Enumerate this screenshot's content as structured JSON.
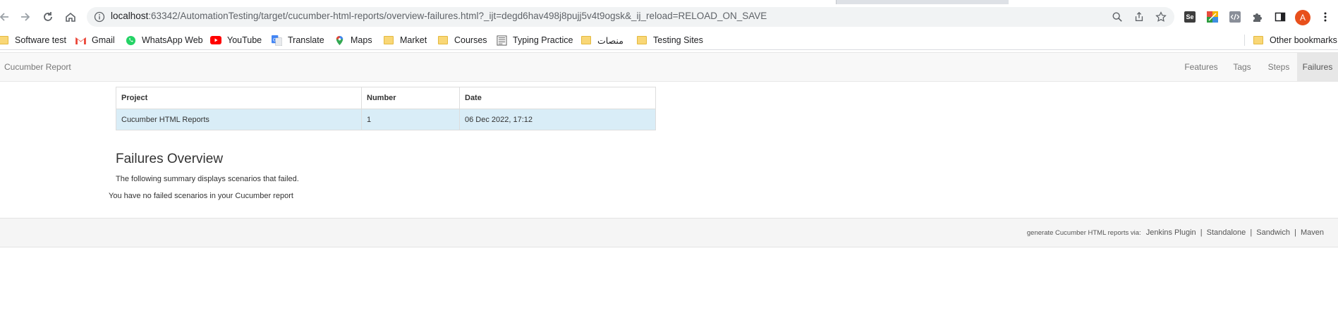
{
  "browser": {
    "url_host": "localhost",
    "url_rest": ":63342/AutomationTesting/target/cucumber-html-reports/overview-failures.html?_ijt=degd6hav498j8pujj5v4t9ogsk&_ij_reload=RELOAD_ON_SAVE",
    "avatar_letter": "A",
    "bookmarks": [
      {
        "label": "Software test",
        "icon": "folder-icon"
      },
      {
        "label": "Gmail",
        "icon": "gmail-icon"
      },
      {
        "label": "WhatsApp Web",
        "icon": "whatsapp-icon"
      },
      {
        "label": "YouTube",
        "icon": "youtube-icon"
      },
      {
        "label": "Translate",
        "icon": "translate-icon"
      },
      {
        "label": "Maps",
        "icon": "maps-icon"
      },
      {
        "label": "Market",
        "icon": "folder-icon"
      },
      {
        "label": "Courses",
        "icon": "folder-icon"
      },
      {
        "label": "Typing Practice",
        "icon": "typing-icon"
      },
      {
        "label": "منصات",
        "icon": "folder-icon"
      },
      {
        "label": "Testing Sites",
        "icon": "folder-icon"
      }
    ],
    "other_bookmarks": "Other bookmarks",
    "extension_labels": {
      "selenium": "Se"
    }
  },
  "navbar": {
    "brand": "Cucumber Report",
    "items": [
      "Features",
      "Tags",
      "Steps",
      "Failures"
    ],
    "active": "Failures"
  },
  "report_table": {
    "headers": [
      "Project",
      "Number",
      "Date"
    ],
    "row": [
      "Cucumber HTML Reports",
      "1",
      "06 Dec 2022, 17:12"
    ]
  },
  "overview": {
    "title": "Failures Overview",
    "summary": "The following summary displays scenarios that failed.",
    "empty_message": "You have no failed scenarios in your Cucumber report"
  },
  "footer": {
    "prefix": "generate Cucumber HTML reports via:",
    "links": [
      "Jenkins Plugin",
      "Standalone",
      "Sandwich",
      "Maven"
    ],
    "separator": "|"
  },
  "colors": {
    "avatar": "#e8501c",
    "table_row_bg": "#d9edf7",
    "navbar_bg": "#f8f8f8",
    "active_nav_bg": "#e7e7e7"
  }
}
